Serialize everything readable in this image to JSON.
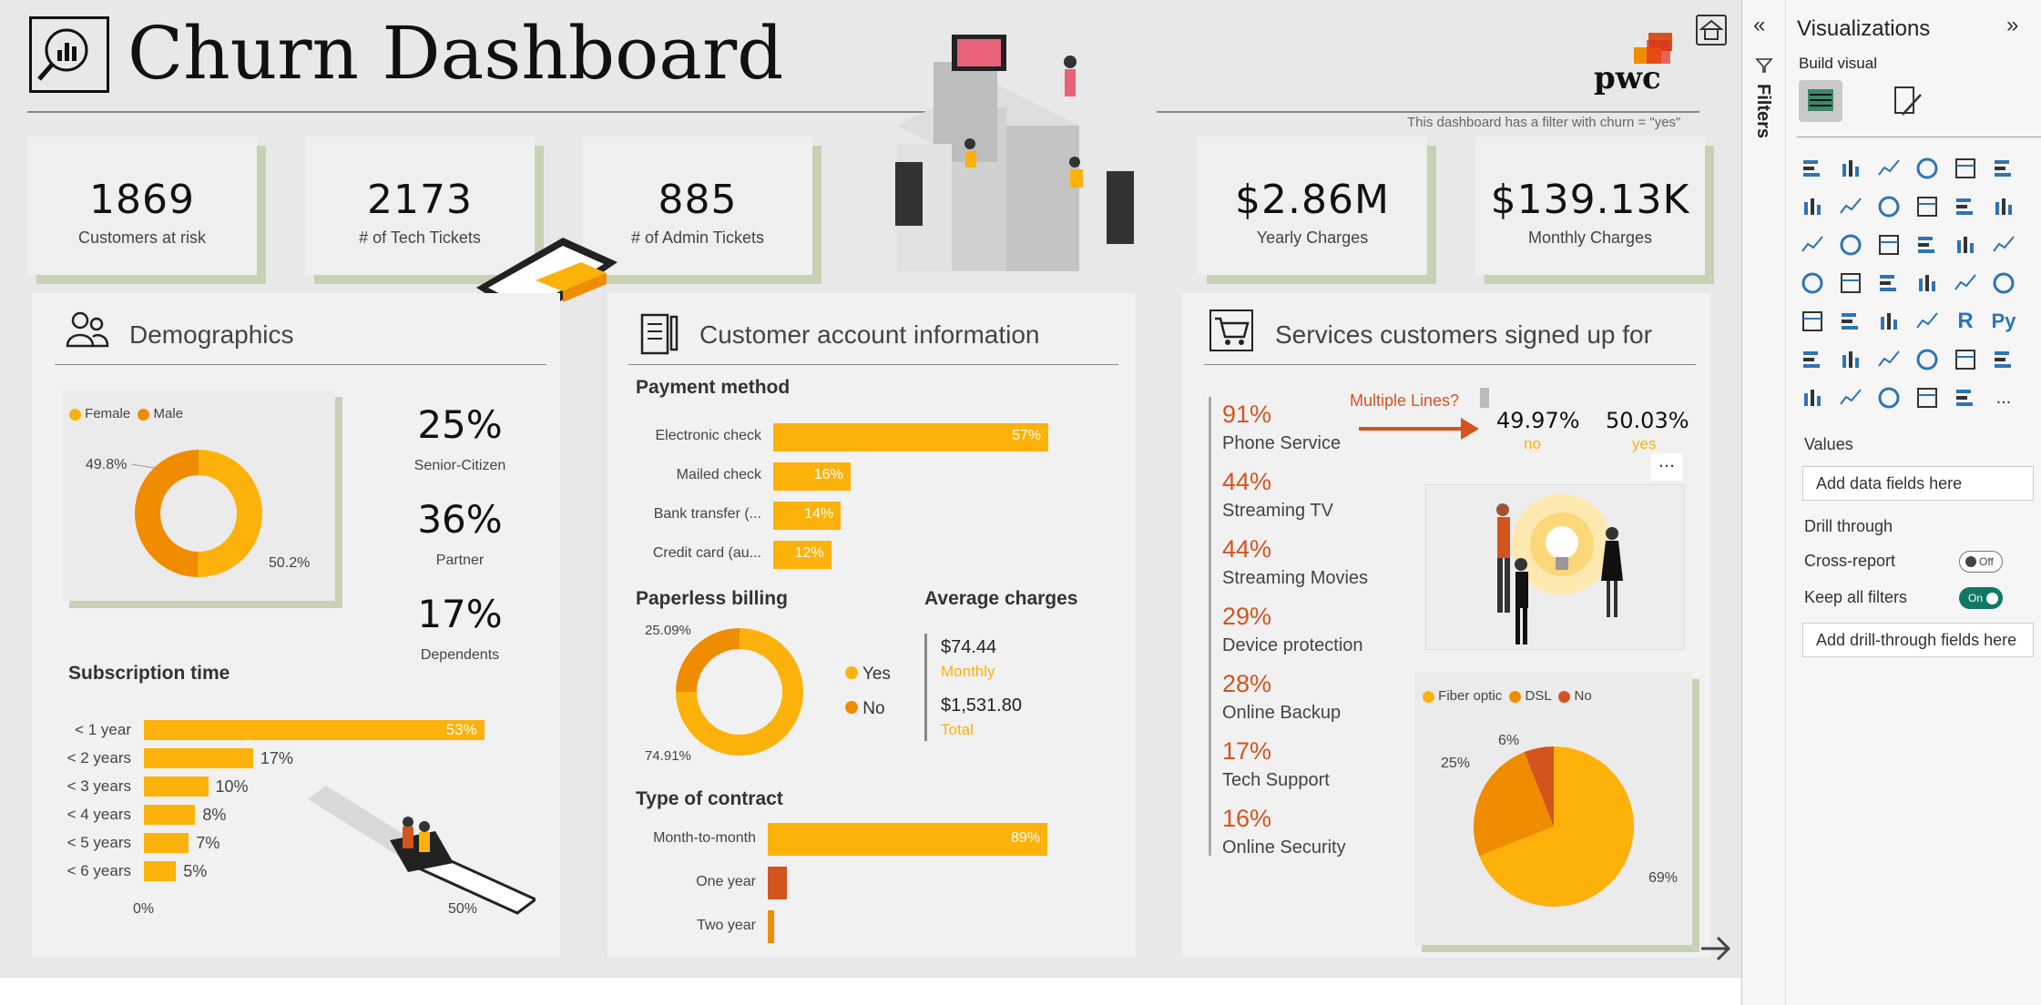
{
  "header": {
    "title": "Churn Dashboard",
    "brand": "pwc",
    "filter_note": "This dashboard has a filter with churn = \"yes\""
  },
  "kpis": [
    {
      "value": "1869",
      "label": "Customers at risk"
    },
    {
      "value": "2173",
      "label": "# of Tech Tickets"
    },
    {
      "value": "885",
      "label": "# of Admin Tickets"
    },
    {
      "value": "$2.86M",
      "label": "Yearly Charges"
    },
    {
      "value": "$139.13K",
      "label": "Monthly Charges"
    }
  ],
  "demographics": {
    "title": "Demographics",
    "legend": [
      "Female",
      "Male"
    ],
    "donut_labels": [
      "49.8%",
      "50.2%"
    ],
    "stats": [
      {
        "value": "25%",
        "label": "Senior-Citizen"
      },
      {
        "value": "36%",
        "label": "Partner"
      },
      {
        "value": "17%",
        "label": "Dependents"
      }
    ],
    "subscription_title": "Subscription time",
    "axis": [
      "0%",
      "50%"
    ]
  },
  "account": {
    "title": "Customer account information",
    "payment_title": "Payment method",
    "paperless_title": "Paperless billing",
    "paperless_labels": [
      "25.09%",
      "74.91%"
    ],
    "paperless_legend": [
      "Yes",
      "No"
    ],
    "avg_title": "Average charges",
    "monthly_value": "$74.44",
    "monthly_label": "Monthly",
    "total_value": "$1,531.80",
    "total_label": "Total",
    "contract_title": "Type of contract"
  },
  "services": {
    "title": "Services customers signed up for",
    "items": [
      {
        "pct": "91%",
        "label": "Phone Service"
      },
      {
        "pct": "44%",
        "label": "Streaming TV"
      },
      {
        "pct": "44%",
        "label": "Streaming Movies"
      },
      {
        "pct": "29%",
        "label": "Device protection"
      },
      {
        "pct": "28%",
        "label": "Online Backup"
      },
      {
        "pct": "17%",
        "label": "Tech Support"
      },
      {
        "pct": "16%",
        "label": "Online Security"
      }
    ],
    "multiple_lines_label": "Multiple Lines?",
    "ml_no_value": "49.97%",
    "ml_no_label": "no",
    "ml_yes_value": "50.03%",
    "ml_yes_label": "yes",
    "more": "...",
    "internet_legend": [
      "Fiber optic",
      "DSL",
      "No"
    ],
    "pie_labels": [
      "6%",
      "25%",
      "69%"
    ]
  },
  "chart_data": [
    {
      "type": "pie",
      "title": "",
      "series": [
        {
          "name": "Female",
          "value": 49.8
        },
        {
          "name": "Male",
          "value": 50.2
        }
      ],
      "colors": [
        "#f08c00",
        "#fcb20a"
      ]
    },
    {
      "type": "bar",
      "title": "Subscription time",
      "categories": [
        "< 1 year",
        "< 2 years",
        "< 3 years",
        "< 4 years",
        "< 5 years",
        "< 6 years"
      ],
      "values": [
        53,
        17,
        10,
        8,
        7,
        5
      ],
      "unit": "%",
      "xlim": [
        0,
        50
      ]
    },
    {
      "type": "bar",
      "title": "Payment method",
      "categories": [
        "Electronic check",
        "Mailed check",
        "Bank transfer (...",
        "Credit card (au..."
      ],
      "values": [
        57,
        16,
        14,
        12
      ],
      "unit": "%"
    },
    {
      "type": "pie",
      "title": "Paperless billing",
      "series": [
        {
          "name": "Yes",
          "value": 74.91
        },
        {
          "name": "No",
          "value": 25.09
        }
      ],
      "colors": [
        "#fcb20a",
        "#f08c00"
      ]
    },
    {
      "type": "bar",
      "title": "Type of contract",
      "categories": [
        "Month-to-month",
        "One year",
        "Two year"
      ],
      "values": [
        89,
        6,
        2
      ],
      "unit": "%",
      "data_labels": [
        "89%",
        "",
        ""
      ]
    },
    {
      "type": "pie",
      "title": "",
      "series": [
        {
          "name": "Fiber optic",
          "value": 69
        },
        {
          "name": "DSL",
          "value": 25
        },
        {
          "name": "No",
          "value": 6
        }
      ],
      "colors": [
        "#fcb20a",
        "#f08c00",
        "#d4541e"
      ]
    }
  ],
  "sidebar": {
    "filters_label": "Filters",
    "title": "Visualizations",
    "build_visual": "Build visual",
    "values_label": "Values",
    "values_placeholder": "Add data fields here",
    "drill_title": "Drill through",
    "cross_report": "Cross-report",
    "cross_state": "Off",
    "keep_filters": "Keep all filters",
    "keep_state": "On",
    "drill_placeholder": "Add drill-through fields here",
    "r_label": "R",
    "py_label": "Py",
    "more": "..."
  },
  "colors": {
    "accent": "#fcb20a",
    "dark_orange": "#f08c00",
    "red_orange": "#d4541e",
    "shadow": "#c7d1b4"
  }
}
